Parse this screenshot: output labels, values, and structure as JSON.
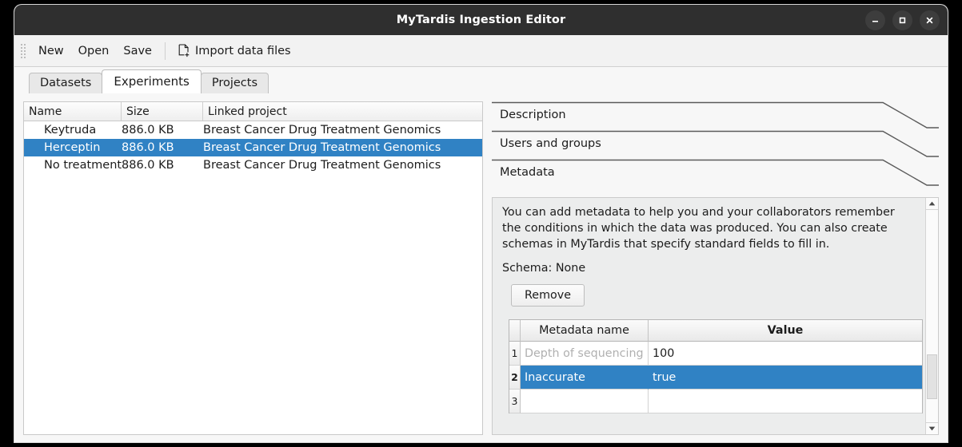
{
  "window": {
    "title": "MyTardis Ingestion Editor",
    "controls": [
      {
        "name": "minimize",
        "glyph": "minimize-icon"
      },
      {
        "name": "maximize",
        "glyph": "maximize-icon"
      },
      {
        "name": "close",
        "glyph": "close-icon"
      }
    ]
  },
  "toolbar": {
    "new_label": "New",
    "open_label": "Open",
    "save_label": "Save",
    "import_label": "Import data files",
    "import_icon": "file-add-icon"
  },
  "tabs": [
    {
      "label": "Datasets",
      "active": false
    },
    {
      "label": "Experiments",
      "active": true
    },
    {
      "label": "Projects",
      "active": false
    }
  ],
  "experiment_list": {
    "columns": [
      "Name",
      "Size",
      "Linked project"
    ],
    "rows": [
      {
        "name": "Keytruda",
        "size": "886.0 KB",
        "project": "Breast Cancer Drug Treatment Genomics",
        "selected": false
      },
      {
        "name": "Herceptin",
        "size": "886.0 KB",
        "project": "Breast Cancer Drug Treatment Genomics",
        "selected": true
      },
      {
        "name": "No treatment",
        "size": "886.0 KB",
        "project": "Breast Cancer Drug Treatment Genomics",
        "selected": false
      }
    ]
  },
  "sections": [
    {
      "label": "Description",
      "expanded": false
    },
    {
      "label": "Users and groups",
      "expanded": false
    },
    {
      "label": "Metadata",
      "expanded": true
    }
  ],
  "metadata_panel": {
    "description": "You can add metadata to help you and your collaborators remember the conditions in which the data was produced. You can also create schemas in MyTardis that specify standard fields to fill in.",
    "schema_text": "Schema: None",
    "remove_label": "Remove",
    "table": {
      "columns": [
        "Metadata name",
        "Value"
      ],
      "rows": [
        {
          "num": "1",
          "name": "Depth of sequencing",
          "value": "100",
          "selected": false,
          "name_is_placeholder": true
        },
        {
          "num": "2",
          "name": "Inaccurate",
          "value": "true",
          "selected": true,
          "name_is_placeholder": false
        },
        {
          "num": "3",
          "name": "",
          "value": "",
          "selected": false,
          "name_is_placeholder": false
        }
      ]
    },
    "scrollbar": {
      "up_icon": "caret-up-icon",
      "down_icon": "caret-down-icon"
    }
  },
  "colors": {
    "selection_blue": "#3082c4",
    "titlebar": "#2f2f2f",
    "panel_bg": "#eceded",
    "window_bg": "#f7f7f7"
  }
}
